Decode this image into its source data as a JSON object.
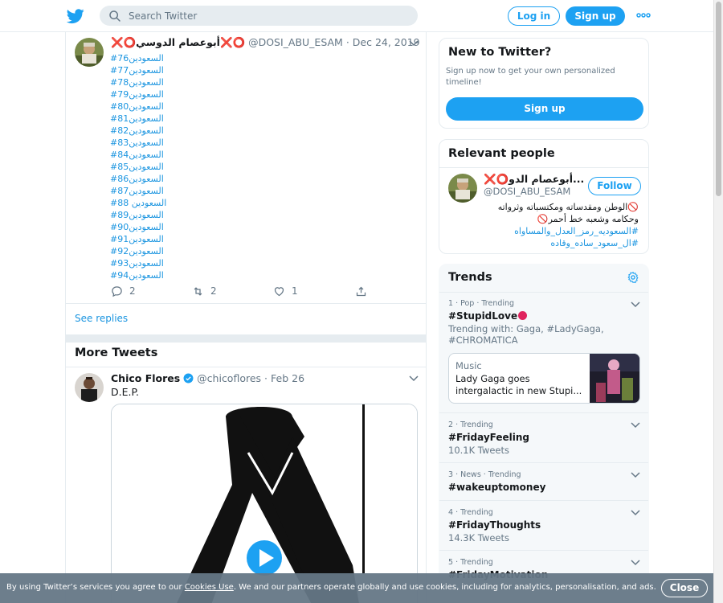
{
  "header": {
    "search_placeholder": "Search Twitter",
    "login_label": "Log in",
    "signup_label": "Sign up"
  },
  "tweet": {
    "name": "❌⭕أبوعصام الدوسي❌⭕",
    "handle": "@DOSI_ABU_ESAM",
    "date": "Dec 24, 2019",
    "lines": [
      "#السعودين76",
      "#السعودين77",
      "#السعودين78",
      "#السعودين79",
      "#السعودين80",
      "#السعودين81",
      "#السعودين82",
      "#السعودين83",
      "#السعودين84",
      "#السعودين85",
      "#السعودين86",
      "#السعودين87",
      "#السعودين 88",
      "#السعودين89",
      "#السعودين90",
      "#السعودين91",
      "#السعودين92",
      "#السعودين93",
      "#السعودين94"
    ],
    "reply_count": "2",
    "retweet_count": "2",
    "like_count": "1"
  },
  "see_replies_label": "See replies",
  "more_tweets_label": "More Tweets",
  "tweet2": {
    "name": "Chico Flores",
    "handle": "@chicoflores",
    "date": "Feb 26",
    "text": "D.E.P."
  },
  "new_to_twitter": {
    "title": "New to Twitter?",
    "description": "Sign up now to get your own personalized timeline!",
    "signup_label": "Sign up"
  },
  "relevant_people": {
    "title": "Relevant people",
    "name": "❌⭕أبوعصام الدو...",
    "handle": "@DOSI_ABU_ESAM",
    "follow_label": "Follow",
    "bio_line1": "🚫الوطن ومقدساته ومكتسباته وثرواته",
    "bio_line2": "وحكامه وشعبه خط أحمر🚫",
    "bio_line3": "#السعوديه_رمز_العدل_والمساواه",
    "bio_line4": "#ال_سعود_ساده_وقاده"
  },
  "trends": {
    "title": "Trends",
    "items": [
      {
        "meta": "1 · Pop · Trending",
        "name": "#StupidLove",
        "sub": "Trending with: Gaga, #LadyGaga, #CHROMATICA"
      },
      {
        "meta": "2 · Trending",
        "name": "#FridayFeeling",
        "sub": "10.1K Tweets"
      },
      {
        "meta": "3 · News · Trending",
        "name": "#wakeuptomoney",
        "sub": ""
      },
      {
        "meta": "4 · Trending",
        "name": "#FridayThoughts",
        "sub": "14.3K Tweets"
      },
      {
        "meta": "5 · Trending",
        "name": "#FridayMotivation",
        "sub": ""
      }
    ],
    "card": {
      "category": "Music",
      "title": "Lady Gaga goes intergalactic in new Stupi..."
    }
  },
  "cookie": {
    "text_before": "By using Twitter’s services you agree to our ",
    "link": "Cookies Use",
    "text_after": ". We and our partners operate globally and use cookies, including for analytics, personalisation, and ads.",
    "close_label": "Close"
  },
  "colors": {
    "accent": "#1da1f2",
    "link": "#1b95e0",
    "muted": "#657786",
    "border": "#e6ecf0"
  }
}
